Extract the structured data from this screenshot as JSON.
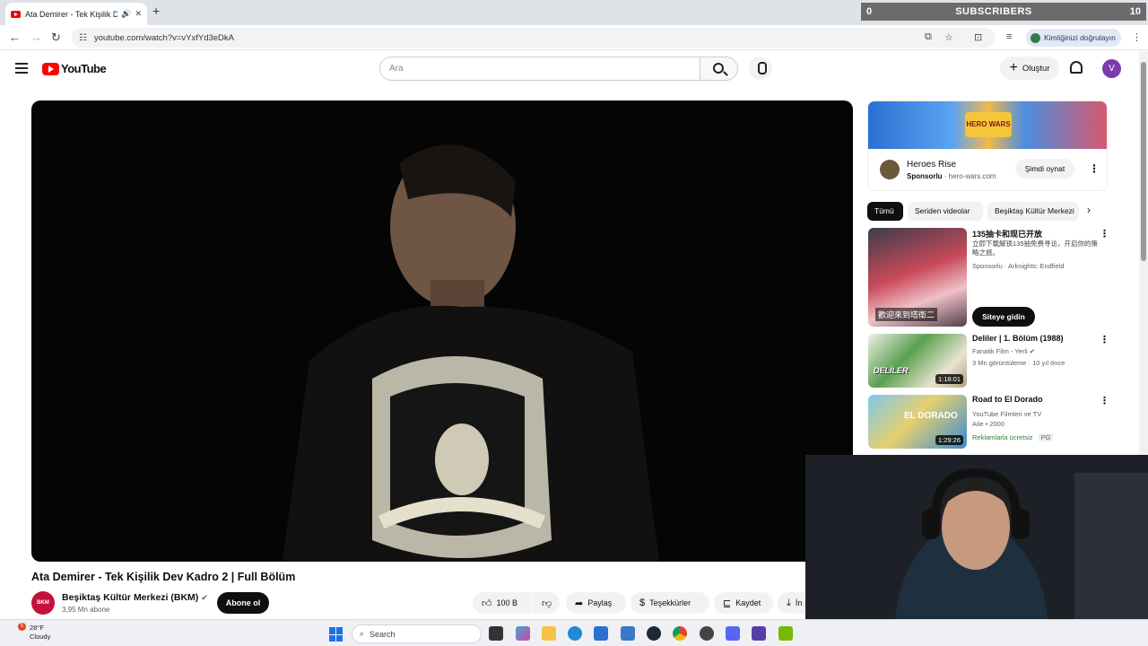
{
  "browser": {
    "tab_title": "Ata Demirer - Tek Kişilik Dev",
    "url": "youtube.com/watch?v=vYxfYd3eDkA",
    "verify_label": "Kimliğinizi doğrulayın"
  },
  "overlay": {
    "left": "0",
    "label": "SUBSCRIBERS",
    "right": "10"
  },
  "youtube": {
    "logo_text": "YouTube",
    "search_placeholder": "Ara",
    "create_label": "Oluştur",
    "avatar_letter": "V"
  },
  "video": {
    "title": "Ata Demirer - Tek Kişilik Dev Kadro 2 | Full Bölüm",
    "channel_logo": "BKM",
    "channel": "Beşiktaş Kültür Merkezi (BKM)",
    "subscribers": "3,95 Mn abone",
    "subscribe_label": "Abone ol",
    "actions": {
      "like": "100 B",
      "share": "Paylaş",
      "thanks": "Teşekkürler",
      "save": "Kaydet",
      "download": "İn"
    }
  },
  "ad": {
    "banner_logo": "HERO WARS",
    "title": "Heroes Rise",
    "sponsored": "Sponsorlu",
    "domain": "hero-wars.com",
    "cta": "Şimdi oynat"
  },
  "chips": [
    "Tümü",
    "Seriden videolar",
    "Beşiktaş Kültür Merkezi"
  ],
  "recommendations": [
    {
      "title": "135抽卡和现已开放",
      "desc": "立即下载解锁135抽免费寻访，开启你的策略之旅。",
      "meta": "Sponsorlu · Arknights: Endfield",
      "thumb_caption": "歡迎來到塔衛二",
      "cta": "Siteye gidin"
    },
    {
      "title": "Deliler | 1. Bölüm (1988)",
      "channel": "Fanatik Film - Yerli",
      "meta": "3 Mn görüntüleme · 10 yıl önce",
      "duration": "1:18:01",
      "thumb_text": "DELİLER"
    },
    {
      "title": "Road to El Dorado",
      "channel": "YouTube Filmleri ve TV",
      "meta": "Aile • 2000",
      "free": "Reklamlarla ücretsiz",
      "rating": "PG",
      "duration": "1:29:26",
      "thumb_text": "EL DORADO"
    }
  ],
  "taskbar": {
    "weather_temp": "28°F",
    "weather_desc": "Cloudy",
    "badge": "5",
    "search_label": "Search"
  }
}
